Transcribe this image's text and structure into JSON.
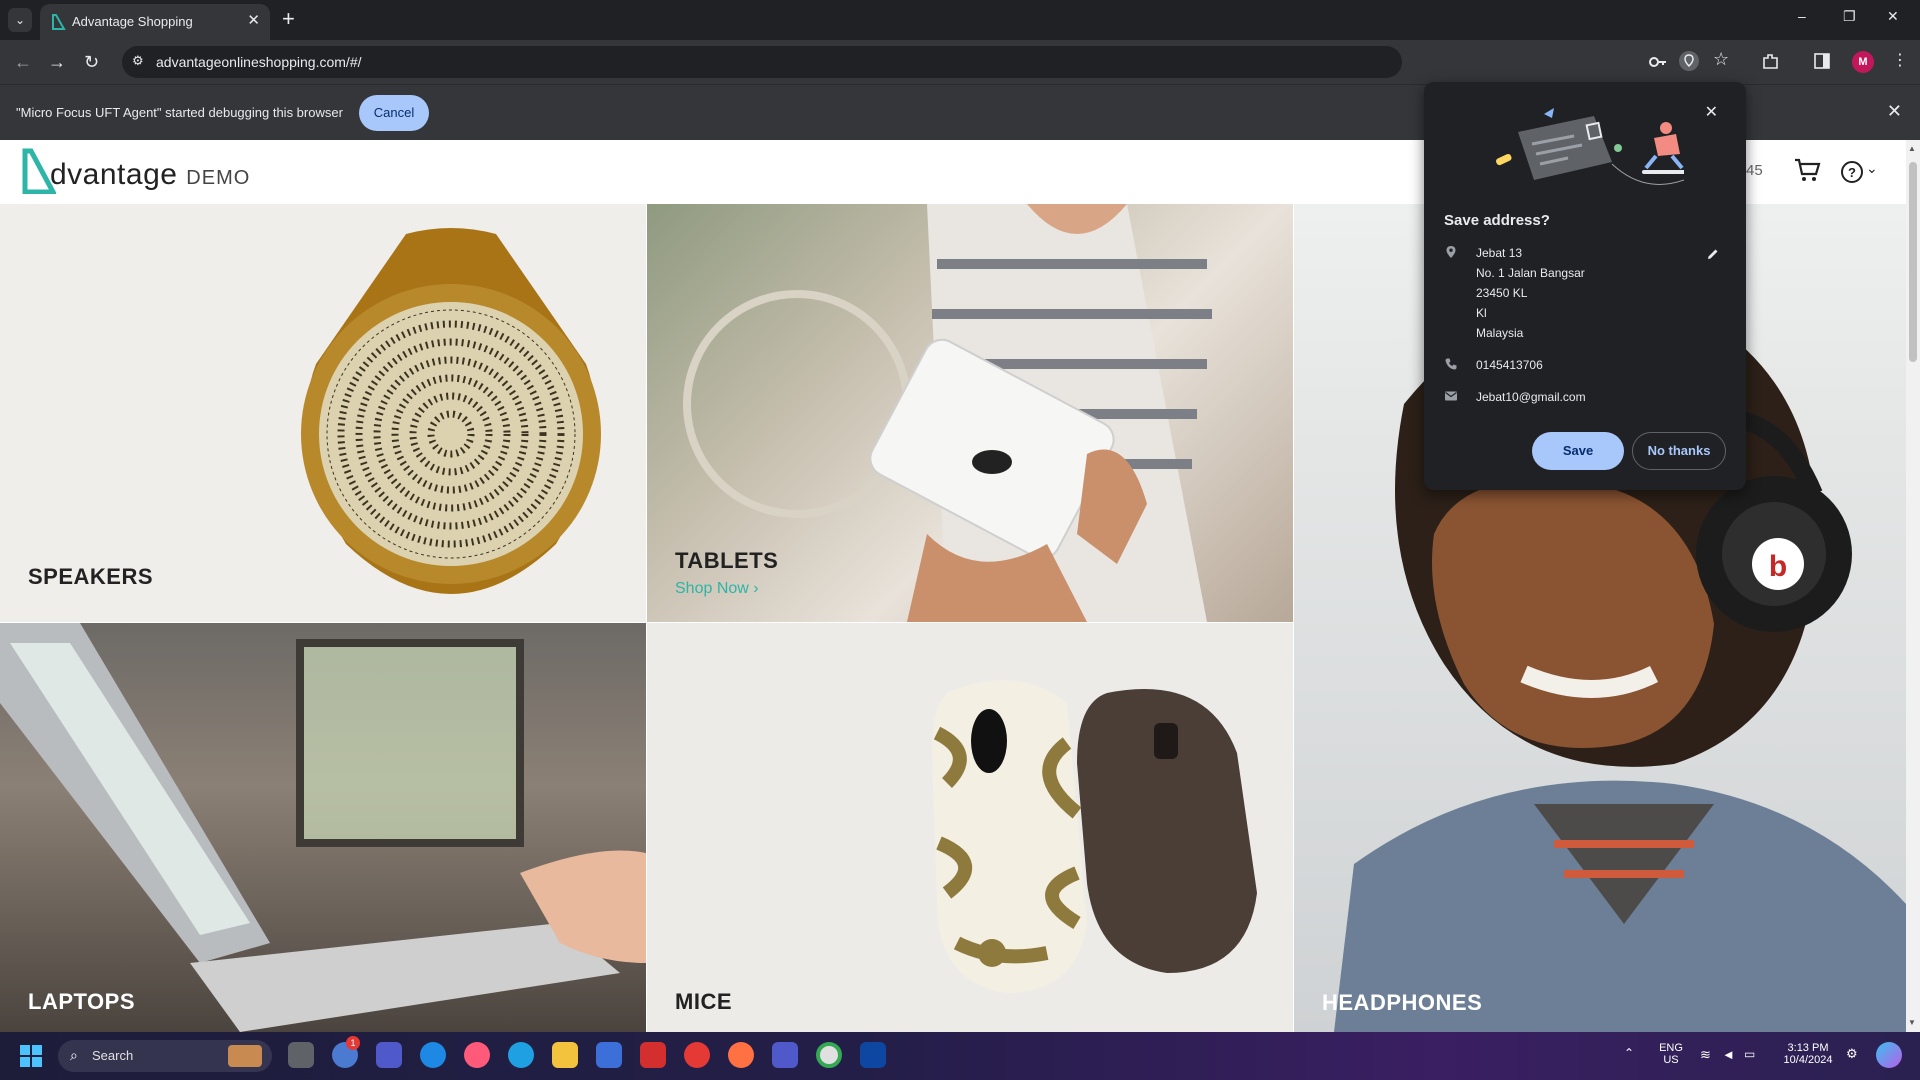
{
  "browser": {
    "tab_title": "Advantage Shopping",
    "tab_close": "✕",
    "new_tab": "+",
    "url": "advantageonlineshopping.com/#/",
    "window_controls": {
      "minimize": "–",
      "restore": "❐",
      "close": "✕"
    }
  },
  "infobar": {
    "message": "\"Micro Focus UFT Agent\" started debugging this browser",
    "cancel_label": "Cancel"
  },
  "site": {
    "logo_main": "dvantage",
    "logo_demo": "DEMO",
    "header_number": "45",
    "brand_color": "#2db5a7"
  },
  "tiles": {
    "speakers": "SPEAKERS",
    "tablets": "TABLETS",
    "shop_now": "Shop Now",
    "laptops": "LAPTOPS",
    "mice": "MICE",
    "headphones": "HEADPHONES"
  },
  "popup": {
    "title": "Save address?",
    "address_lines": [
      "Jebat 13",
      "No. 1 Jalan Bangsar",
      "23450 KL",
      "Kl",
      "Malaysia"
    ],
    "phone": "0145413706",
    "email": "Jebat10@gmail.com",
    "save_label": "Save",
    "no_thanks_label": "No thanks"
  },
  "taskbar": {
    "search_label": "Search",
    "lang_top": "ENG",
    "lang_bottom": "US",
    "time": "3:13 PM",
    "date": "10/4/2024",
    "notif_badge": "1"
  }
}
